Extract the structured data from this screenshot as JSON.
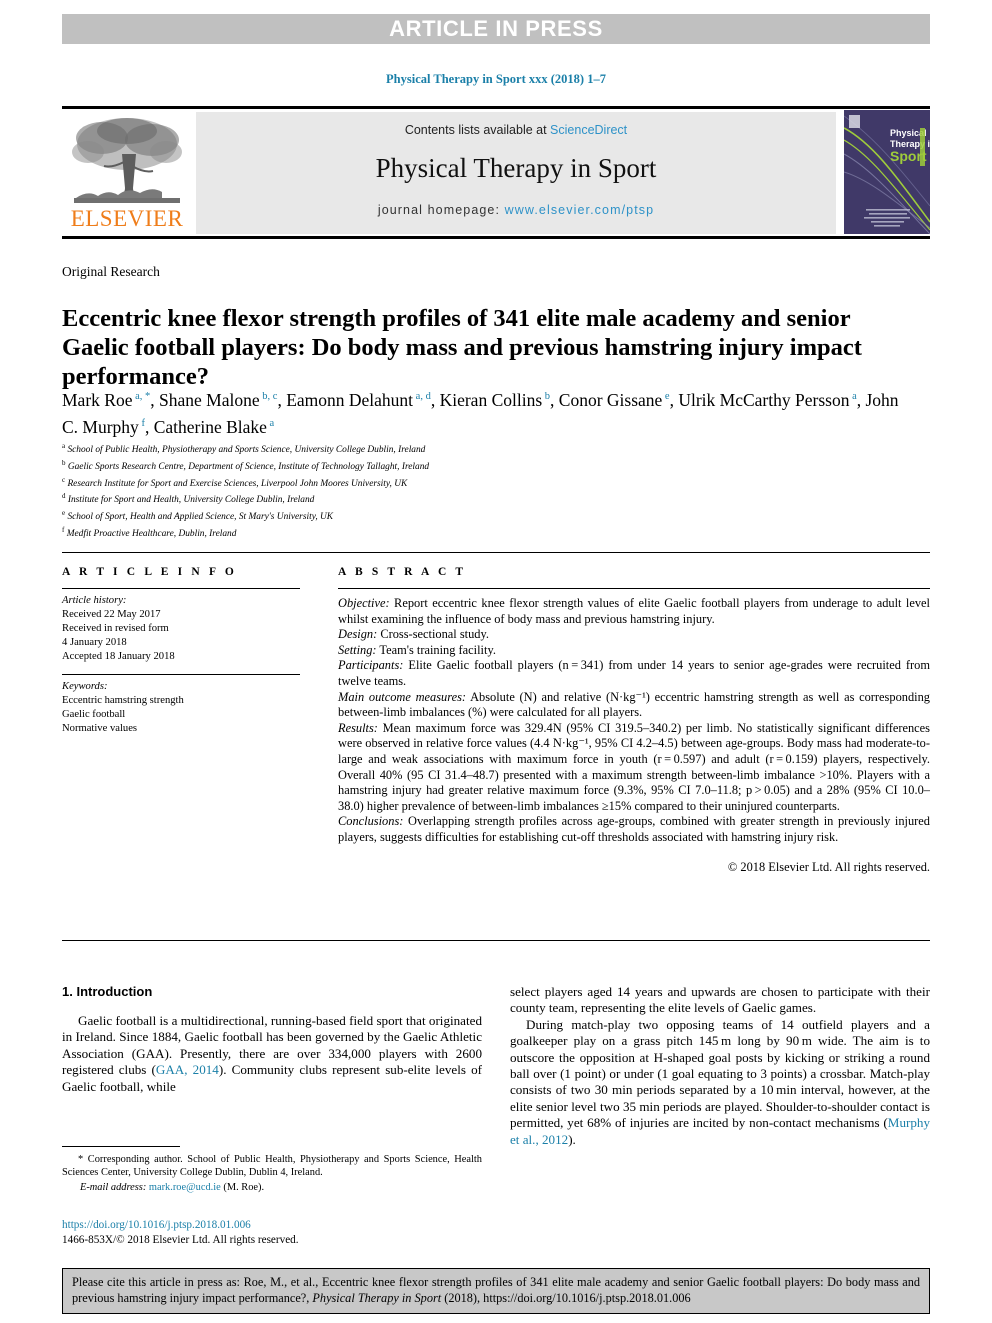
{
  "banner": {
    "label": "ARTICLE IN PRESS"
  },
  "running_head": {
    "text": "Physical Therapy in Sport xxx (2018) 1–7"
  },
  "masthead": {
    "contents_prefix": "Contents lists available at ",
    "sciencedirect": "ScienceDirect",
    "journal_title": "Physical Therapy in Sport",
    "homepage_prefix": "journal homepage: ",
    "homepage_url": "www.elsevier.com/ptsp",
    "publisher": "ELSEVIER",
    "cover_lines": [
      "Physical",
      "Therapy in",
      "Sport"
    ]
  },
  "section_label": "Original Research",
  "title": "Eccentric knee flexor strength profiles of 341 elite male academy and senior Gaelic football players: Do body mass and previous hamstring injury impact performance?",
  "authors": [
    {
      "name": "Mark Roe",
      "marks": "a, *",
      "sep": ", "
    },
    {
      "name": "Shane Malone",
      "marks": "b, c",
      "sep": ", "
    },
    {
      "name": "Eamonn Delahunt",
      "marks": "a, d",
      "sep": ", "
    },
    {
      "name": "Kieran Collins",
      "marks": "b",
      "sep": ", "
    },
    {
      "name": "Conor Gissane",
      "marks": "e",
      "sep": ", "
    },
    {
      "name": "Ulrik McCarthy Persson",
      "marks": "a",
      "sep": ", "
    },
    {
      "name": "John C. Murphy",
      "marks": "f",
      "sep": ", "
    },
    {
      "name": "Catherine Blake",
      "marks": "a",
      "sep": ""
    }
  ],
  "affiliations": [
    {
      "mark": "a",
      "text": "School of Public Health, Physiotherapy and Sports Science, University College Dublin, Ireland"
    },
    {
      "mark": "b",
      "text": "Gaelic Sports Research Centre, Department of Science, Institute of Technology Tallaght, Ireland"
    },
    {
      "mark": "c",
      "text": "Research Institute for Sport and Exercise Sciences, Liverpool John Moores University, UK"
    },
    {
      "mark": "d",
      "text": "Institute for Sport and Health, University College Dublin, Ireland"
    },
    {
      "mark": "e",
      "text": "School of Sport, Health and Applied Science, St Mary's University, UK"
    },
    {
      "mark": "f",
      "text": "Medfit Proactive Healthcare, Dublin, Ireland"
    }
  ],
  "article_info": {
    "heading": "A R T I C L E  I N F O",
    "history_label": "Article history:",
    "history_lines": [
      "Received 22 May 2017",
      "Received in revised form",
      "4 January 2018",
      "Accepted 18 January 2018"
    ],
    "keywords_label": "Keywords:",
    "keywords": [
      "Eccentric hamstring strength",
      "Gaelic football",
      "Normative values"
    ]
  },
  "abstract": {
    "heading": "A B S T R A C T",
    "sections": [
      {
        "label": "Objective:",
        "text": " Report eccentric knee flexor strength values of elite Gaelic football players from underage to adult level whilst examining the influence of body mass and previous hamstring injury."
      },
      {
        "label": "Design:",
        "text": " Cross-sectional study."
      },
      {
        "label": "Setting:",
        "text": " Team's training facility."
      },
      {
        "label": "Participants:",
        "text": " Elite Gaelic football players (n = 341) from under 14 years to senior age-grades were recruited from twelve teams."
      },
      {
        "label": "Main outcome measures:",
        "text": " Absolute (N) and relative (N·kg⁻¹) eccentric hamstring strength as well as corresponding between-limb imbalances (%) were calculated for all players."
      },
      {
        "label": "Results:",
        "text": " Mean maximum force was 329.4N (95% CI 319.5–340.2) per limb. No statistically significant differences were observed in relative force values (4.4 N·kg⁻¹, 95% CI 4.2–4.5) between age-groups. Body mass had moderate-to-large and weak associations with maximum force in youth (r = 0.597) and adult (r = 0.159) players, respectively. Overall 40% (95 CI 31.4–48.7) presented with a maximum strength between-limb imbalance >10%. Players with a hamstring injury had greater relative maximum force (9.3%, 95% CI 7.0–11.8; p > 0.05) and a 28% (95% CI 10.0–38.0) higher prevalence of between-limb imbalances ≥15% compared to their uninjured counterparts."
      },
      {
        "label": "Conclusions:",
        "text": " Overlapping strength profiles across age-groups, combined with greater strength in previously injured players, suggests difficulties for establishing cut-off thresholds associated with hamstring injury risk."
      }
    ],
    "copyright": "© 2018 Elsevier Ltd. All rights reserved."
  },
  "introduction": {
    "heading": "1. Introduction",
    "left_paragraphs": [
      "Gaelic football is a multidirectional, running-based field sport that originated in Ireland. Since 1884, Gaelic football has been governed by the Gaelic Athletic Association (GAA). Presently, there are over 334,000 players with 2600 registered clubs (",
      "Community clubs represent sub-elite levels of Gaelic football, while"
    ],
    "left_ref": "GAA, 2014",
    "left_after_ref": "). ",
    "right_paragraphs": [
      "select players aged 14 years and upwards are chosen to participate with their county team, representing the elite levels of Gaelic games.",
      "During match-play two opposing teams of 14 outfield players and a goalkeeper play on a grass pitch 145 m long by 90 m wide. The aim is to outscore the opposition at H-shaped goal posts by kicking or striking a round ball over (1 point) or under (1 goal equating to 3 points) a crossbar. Match-play consists of two 30 min periods separated by a 10 min interval, however, at the elite senior level two 35 min periods are played. Shoulder-to-shoulder contact is permitted, yet 68% of injuries are incited by non-contact mechanisms ("
    ],
    "right_ref": "Murphy et al., 2012",
    "right_after_ref": ")."
  },
  "footnote": {
    "corresponding": "* Corresponding author. School of Public Health, Physiotherapy and Sports Science, Health Sciences Center, University College Dublin, Dublin 4, Ireland.",
    "email_label": "E-mail address:",
    "email": "mark.roe@ucd.ie",
    "email_suffix": " (M. Roe).",
    "doi": "https://doi.org/10.1016/j.ptsp.2018.01.006",
    "issn_line": "1466-853X/© 2018 Elsevier Ltd. All rights reserved."
  },
  "cite_box": {
    "prefix": "Please cite this article in press as: Roe, M., et al., Eccentric knee flexor strength profiles of 341 elite male academy and senior Gaelic football players: Do body mass and previous hamstring injury impact performance?, ",
    "journal": "Physical Therapy in Sport",
    "suffix": " (2018), https://doi.org/10.1016/j.ptsp.2018.01.006"
  },
  "colors": {
    "link": "#1a7fa8",
    "sciencedirect": "#2e92c8",
    "elsevier_orange": "#ef7d1a",
    "banner_gray": "#c0c0c0",
    "masthead_gray": "#e8e8e8",
    "cite_gray": "#c8c8c8",
    "cover_purple": "#3b3560",
    "cover_green": "#9fcc3b"
  }
}
